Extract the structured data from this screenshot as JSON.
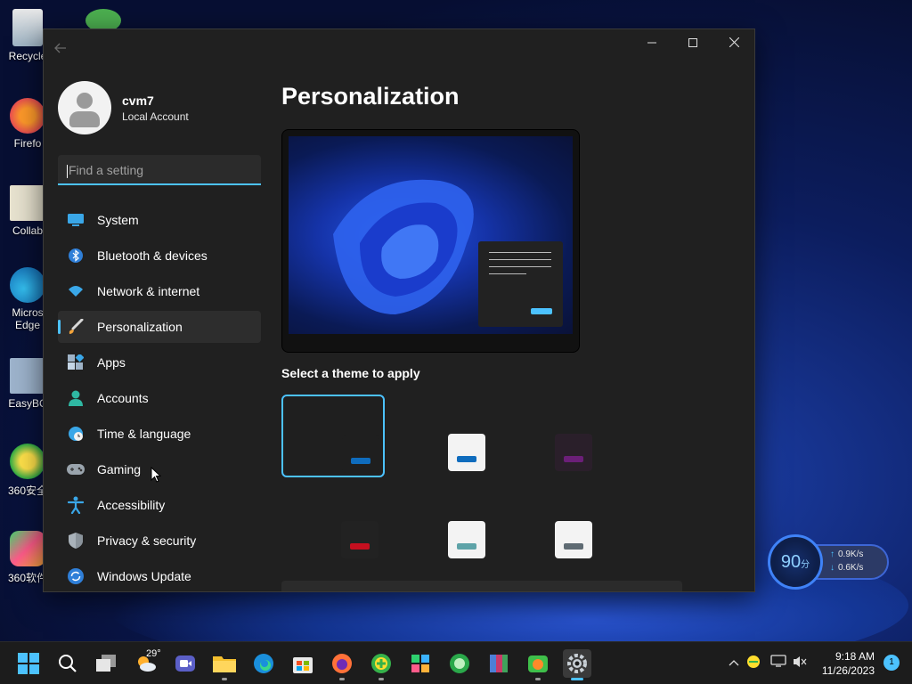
{
  "desktop": {
    "icons": [
      {
        "label": "Recycle",
        "icon": "recycle-bin-icon"
      },
      {
        "label": "Firefo",
        "icon": "firefox-icon"
      },
      {
        "label": "Collab",
        "icon": "certificate-icon"
      },
      {
        "label": "Micros Edge",
        "icon": "edge-icon"
      },
      {
        "label": "EasyBC",
        "icon": "easybcd-icon"
      },
      {
        "label": "360安全",
        "icon": "360-security-icon"
      },
      {
        "label": "360软件",
        "icon": "360-software-icon"
      }
    ]
  },
  "window": {
    "profile": {
      "name": "cvm7",
      "account_type": "Local Account"
    },
    "search": {
      "placeholder": "Find a setting"
    },
    "nav": [
      {
        "label": "System",
        "icon": "system-icon"
      },
      {
        "label": "Bluetooth & devices",
        "icon": "bluetooth-icon"
      },
      {
        "label": "Network & internet",
        "icon": "wifi-icon"
      },
      {
        "label": "Personalization",
        "icon": "brush-icon",
        "active": true
      },
      {
        "label": "Apps",
        "icon": "apps-icon"
      },
      {
        "label": "Accounts",
        "icon": "accounts-icon"
      },
      {
        "label": "Time & language",
        "icon": "globe-clock-icon"
      },
      {
        "label": "Gaming",
        "icon": "gamepad-icon"
      },
      {
        "label": "Accessibility",
        "icon": "accessibility-icon"
      },
      {
        "label": "Privacy & security",
        "icon": "shield-icon"
      },
      {
        "label": "Windows Update",
        "icon": "update-icon"
      }
    ],
    "page_title": "Personalization",
    "theme_section_label": "Select a theme to apply",
    "themes": [
      {
        "window_color": "#1f1f1f",
        "accent": "#0f6cbd",
        "selected": true
      },
      {
        "window_color": "#f3f3f3",
        "accent": "#0f6cbd"
      },
      {
        "window_color": "#2a1f2a",
        "accent": "#6b1f78"
      },
      {
        "window_color": "#222222",
        "accent": "#c50f1f"
      },
      {
        "window_color": "#f3f3f3",
        "accent": "#5ea3a8"
      },
      {
        "window_color": "#f3f3f3",
        "accent": "#5f6b73"
      }
    ],
    "accent_color": "#4cc2ff"
  },
  "net_widget": {
    "score": "90",
    "score_unit": "分",
    "upload": "0.9K/s",
    "download": "0.6K/s"
  },
  "taskbar": {
    "weather_temp": "29°",
    "apps": [
      "start-icon",
      "search-icon",
      "task-view-icon",
      "weather-icon",
      "meet-icon",
      "file-explorer-icon",
      "edge-icon",
      "store-icon",
      "firefox-icon",
      "360-security-icon",
      "360-software-icon",
      "360-browser-icon",
      "winrar-icon",
      "game-icon",
      "settings-icon"
    ],
    "clock": {
      "time": "9:18 AM",
      "date": "11/26/2023"
    },
    "notification_count": "1"
  }
}
